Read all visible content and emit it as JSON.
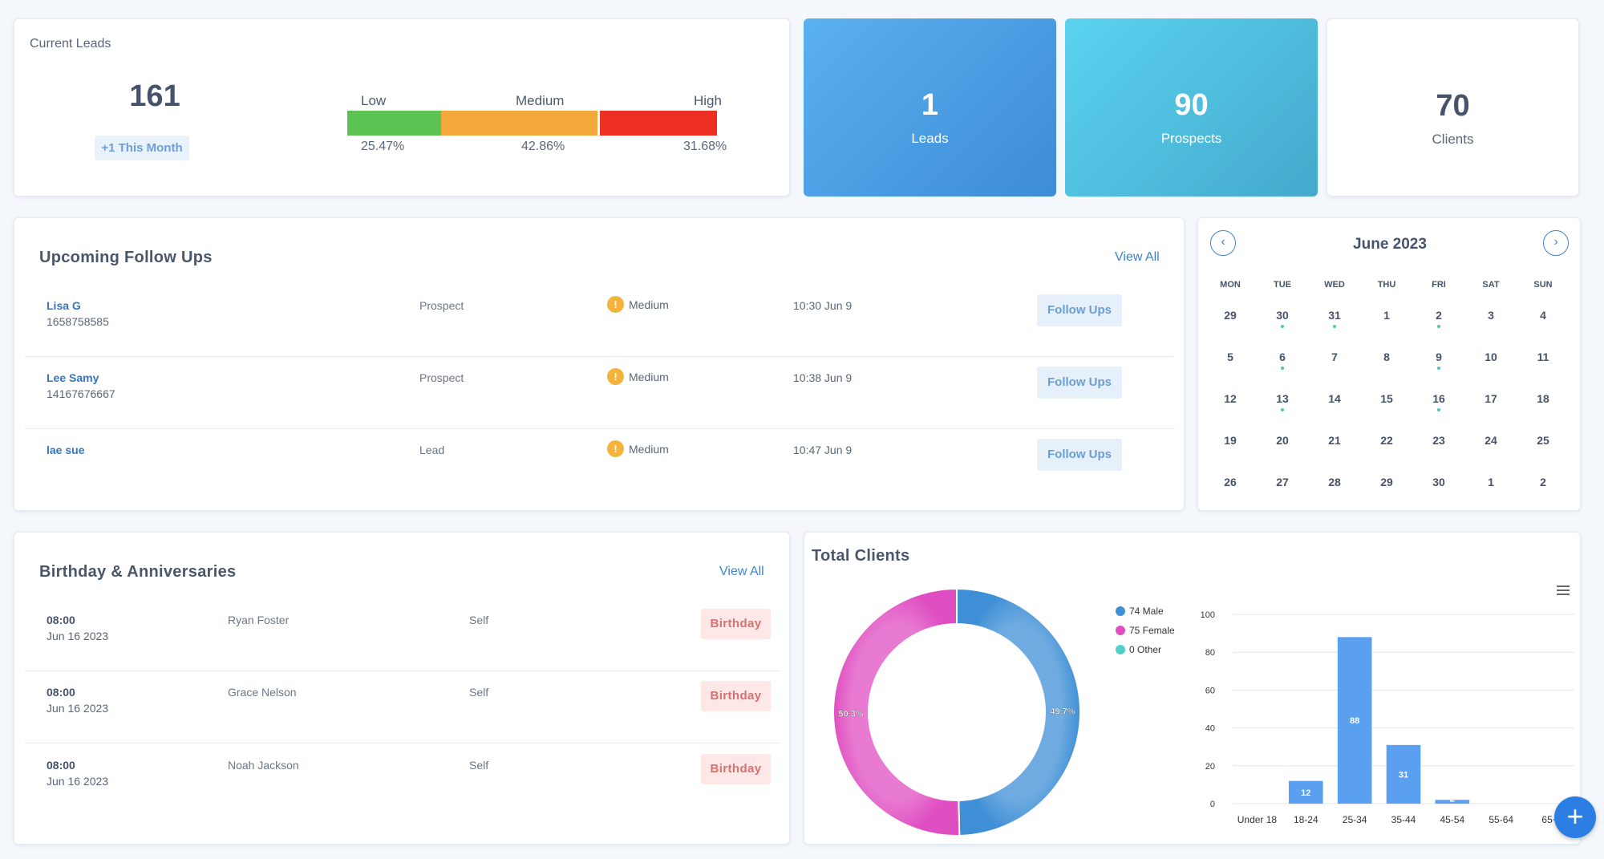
{
  "current_leads": {
    "title": "Current Leads",
    "count": "161",
    "this_month": "+1 This Month",
    "priority_labels": {
      "low": "Low",
      "medium": "Medium",
      "high": "High"
    },
    "priority_pcts": {
      "low": "25.47%",
      "medium": "42.86%",
      "high": "31.68%"
    },
    "priority_values": {
      "low": 25.47,
      "medium": 42.86,
      "high": 31.68
    },
    "priority_colors": {
      "low": "#5bc352",
      "medium": "#f4a73a",
      "high": "#ee3024"
    }
  },
  "stats": {
    "leads": {
      "value": "1",
      "label": "Leads"
    },
    "prospects": {
      "value": "90",
      "label": "Prospects"
    },
    "clients": {
      "value": "70",
      "label": "Clients"
    }
  },
  "follow_ups": {
    "title": "Upcoming Follow Ups",
    "view_all": "View All",
    "rows": [
      {
        "name": "Lisa G",
        "phone": "1658758585",
        "type": "Prospect",
        "priority": "Medium",
        "time": "10:30 Jun 9",
        "action": "Follow Ups"
      },
      {
        "name": "Lee Samy",
        "phone": "14167676667",
        "type": "Prospect",
        "priority": "Medium",
        "time": "10:38 Jun 9",
        "action": "Follow Ups"
      },
      {
        "name": "lae sue",
        "phone": "",
        "type": "Lead",
        "priority": "Medium",
        "time": "10:47 Jun 9",
        "action": "Follow Ups"
      }
    ],
    "priority_icon": "warning-icon"
  },
  "calendar": {
    "title": "June 2023",
    "prev": "‹",
    "next": "›",
    "weekdays": [
      "MON",
      "TUE",
      "WED",
      "THU",
      "FRI",
      "SAT",
      "SUN"
    ],
    "weeks": [
      [
        "29",
        "30",
        "31",
        "1",
        "2",
        "3",
        "4"
      ],
      [
        "5",
        "6",
        "7",
        "8",
        "9",
        "10",
        "11"
      ],
      [
        "12",
        "13",
        "14",
        "15",
        "16",
        "17",
        "18"
      ],
      [
        "19",
        "20",
        "21",
        "22",
        "23",
        "24",
        "25"
      ],
      [
        "26",
        "27",
        "28",
        "29",
        "30",
        "1",
        "2"
      ]
    ],
    "marked": [
      [
        0,
        1
      ],
      [
        0,
        2
      ],
      [
        0,
        4
      ],
      [
        1,
        1
      ],
      [
        1,
        4
      ],
      [
        2,
        1
      ],
      [
        2,
        4
      ]
    ]
  },
  "birthdays": {
    "title": "Birthday & Anniversaries",
    "view_all": "View All",
    "rows": [
      {
        "time": "08:00",
        "date": "Jun 16 2023",
        "name": "Ryan Foster",
        "relation": "Self",
        "badge": "Birthday"
      },
      {
        "time": "08:00",
        "date": "Jun 16 2023",
        "name": "Grace Nelson",
        "relation": "Self",
        "badge": "Birthday"
      },
      {
        "time": "08:00",
        "date": "Jun 16 2023",
        "name": "Noah Jackson",
        "relation": "Self",
        "badge": "Birthday"
      }
    ]
  },
  "total_clients": {
    "title": "Total Clients",
    "menu_icon": "hamburger-menu-icon",
    "fab_icon": "plus-icon"
  },
  "chart_data": [
    {
      "type": "pie",
      "labels": [
        "74 Male",
        "75 Female",
        "0 Other"
      ],
      "values": [
        74,
        75,
        0
      ],
      "slice_labels": [
        "49.7%",
        "50.3%",
        ""
      ],
      "colors": [
        "#3f8fd6",
        "#e04fc2",
        "#4fd0c8"
      ],
      "legend_position": "right"
    },
    {
      "type": "bar",
      "categories": [
        "Under 18",
        "18-24",
        "25-34",
        "35-44",
        "45-54",
        "55-64",
        "65+"
      ],
      "values": [
        0,
        12,
        88,
        31,
        2,
        0,
        0
      ],
      "data_labels": [
        "",
        "12",
        "88",
        "31",
        "2",
        "",
        ""
      ],
      "yticks": [
        "0",
        "20",
        "40",
        "60",
        "80",
        "100"
      ],
      "ylim": [
        0,
        100
      ],
      "color": "#5a9ff0",
      "grid": true
    }
  ]
}
